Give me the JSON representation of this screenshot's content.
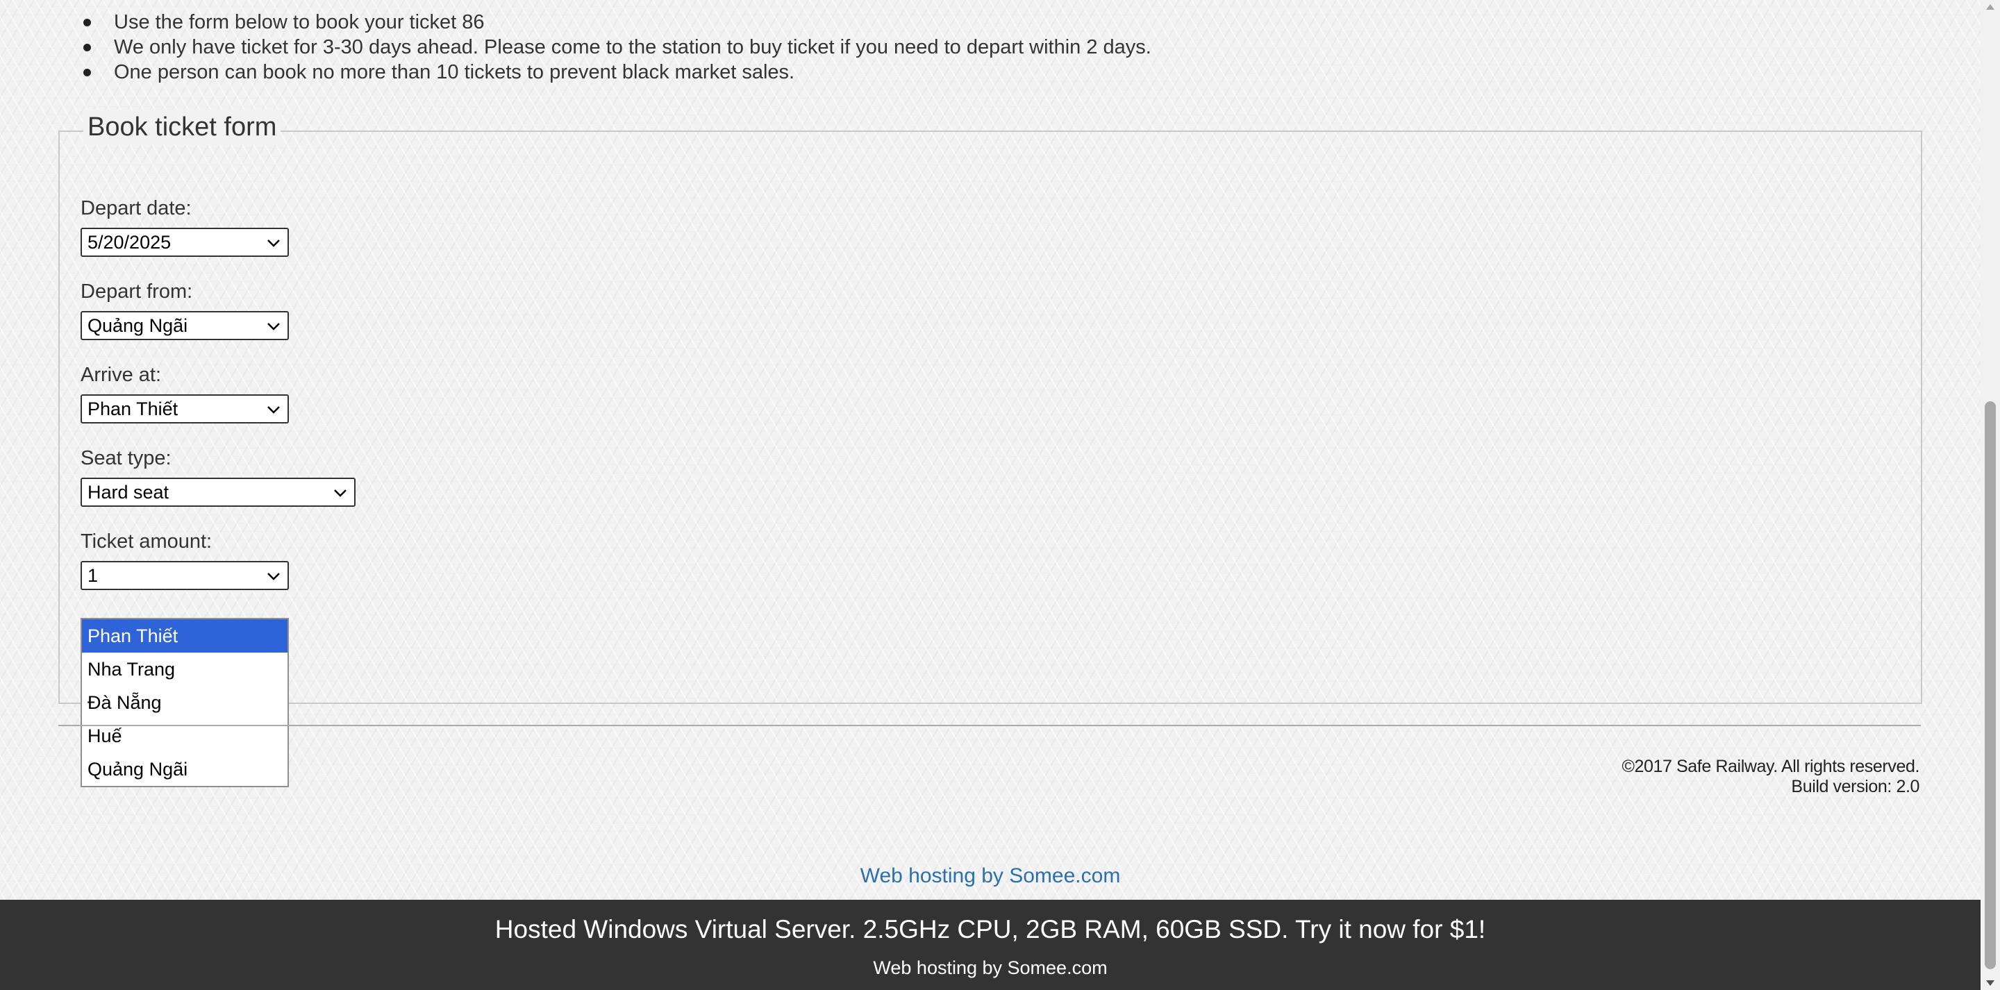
{
  "notes": [
    "Use the form below to book your ticket 86",
    "We only have ticket for 3-30 days ahead. Please come to the station to buy ticket if you need to depart within 2 days.",
    "One person can book no more than 10 tickets to prevent black market sales."
  ],
  "form": {
    "legend": "Book ticket form",
    "depart_date": {
      "label": "Depart date:",
      "value": "5/20/2025"
    },
    "depart_from": {
      "label": "Depart from:",
      "value": "Quảng Ngãi"
    },
    "arrive_at": {
      "label": "Arrive at:",
      "value": "Phan Thiết",
      "options": [
        "Phan Thiết",
        "Nha Trang",
        "Đà Nẵng",
        "Huế",
        "Quảng Ngãi"
      ]
    },
    "seat_type": {
      "label": "Seat type:",
      "value": "Hard seat"
    },
    "ticket_amount": {
      "label": "Ticket amount:",
      "value": "1"
    }
  },
  "footer": {
    "copyright": "©2017 Safe Railway. All rights reserved.",
    "build": "Build version: 2.0"
  },
  "hosting": {
    "link": "Web hosting by Somee.com",
    "promo_headline": "Hosted Windows Virtual Server. 2.5GHz CPU, 2GB RAM, 60GB SSD. Try it now for $1!",
    "promo_sub": "Web hosting by Somee.com"
  },
  "icons": {
    "select_arrow": "chevron-down-icon",
    "list_bullet": "bullet-icon"
  },
  "colors": {
    "selected_option_bg": "#2e64d8",
    "link": "#2a6fb0",
    "promo_bg": "#333333"
  }
}
